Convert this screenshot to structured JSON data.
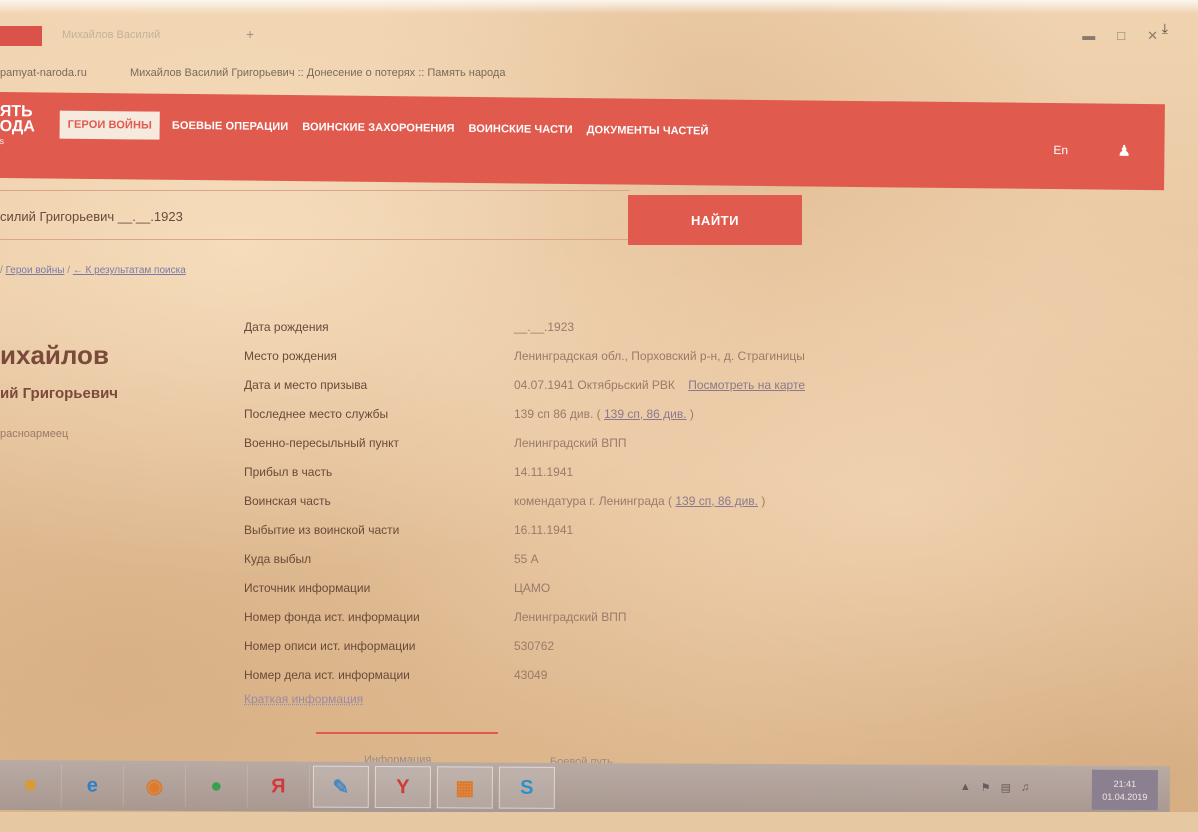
{
  "browser": {
    "tab_title": "Михайлов Василий",
    "url": "pamyat-naroda.ru",
    "page_title": "Михайлов Василий Григорьевич :: Донесение о потерях :: Память народа"
  },
  "nav": {
    "logo_line1": "ЯТЬ",
    "logo_line2": "ОДА",
    "items": [
      {
        "label": "Герои войны",
        "active": true
      },
      {
        "label": "Боевые операции",
        "active": false
      },
      {
        "label": "Воинские захоронения",
        "active": false
      },
      {
        "label": "Воинские части",
        "active": false
      },
      {
        "label": "Документы частей",
        "active": false
      }
    ],
    "lang": "En",
    "user_icon": "user-icon"
  },
  "search": {
    "value": "силий Григорьевич __.__.1923",
    "button": "НАЙТИ"
  },
  "breadcrumb": {
    "sep1": "/ ",
    "item1": "Герои войны",
    "sep2": " / ",
    "back": "← К результатам поиска"
  },
  "person": {
    "surname": "ихайлов",
    "given": "ий Григорьевич",
    "rank": "расноармеец"
  },
  "details": [
    {
      "label": "Дата рождения",
      "value": "__.__.1923"
    },
    {
      "label": "Место рождения",
      "value": "Ленинградская обл., Порховский р-н, д. Страгиницы"
    },
    {
      "label": "Дата и место призыва",
      "value": "04.07.1941 Октябрьский РВК",
      "link": "Посмотреть на карте"
    },
    {
      "label": "Последнее место службы",
      "value": "139 сп 86 див. (",
      "link": "139 сп, 86 див.",
      "tail": " )"
    },
    {
      "label": "Военно-пересыльный пункт",
      "value": "Ленинградский ВПП"
    },
    {
      "label": "Прибыл в часть",
      "value": "14.11.1941"
    },
    {
      "label": "Воинская часть",
      "value": "комендатура г. Ленинграда (",
      "link": "139 сп, 86 див.",
      "tail": " )"
    },
    {
      "label": "Выбытие из воинской части",
      "value": "16.11.1941"
    },
    {
      "label": "Куда выбыл",
      "value": "55 А"
    },
    {
      "label": "Источник информации",
      "value": "ЦАМО"
    },
    {
      "label": "Номер фонда ист. информации",
      "value": "Ленинградский ВПП"
    },
    {
      "label": "Номер описи ист. информации",
      "value": "530762"
    },
    {
      "label": "Номер дела ист. информации",
      "value": "43049"
    }
  ],
  "short_info": "Краткая информация",
  "bottom_tabs": {
    "info": "Информация",
    "path": "Боевой путь"
  },
  "taskbar": {
    "icons": [
      {
        "name": "folder-icon",
        "glyph": "■",
        "color": "#d99a3a"
      },
      {
        "name": "internet-explorer-icon",
        "glyph": "e",
        "color": "#2f7fc9"
      },
      {
        "name": "media-player-icon",
        "glyph": "◉",
        "color": "#e07a2a"
      },
      {
        "name": "chrome-icon",
        "glyph": "●",
        "color": "#3aa050"
      },
      {
        "name": "yandex-icon",
        "glyph": "Я",
        "color": "#d03a3a"
      },
      {
        "name": "paint-icon",
        "glyph": "✎",
        "color": "#4a8ac0"
      },
      {
        "name": "yandex-browser-icon",
        "glyph": "Y",
        "color": "#d03a3a"
      },
      {
        "name": "tiles-icon",
        "glyph": "▦",
        "color": "#e07a2a"
      },
      {
        "name": "skype-icon",
        "glyph": "S",
        "color": "#2f8fc9"
      }
    ],
    "time": "21:41",
    "date": "01.04.2019"
  }
}
